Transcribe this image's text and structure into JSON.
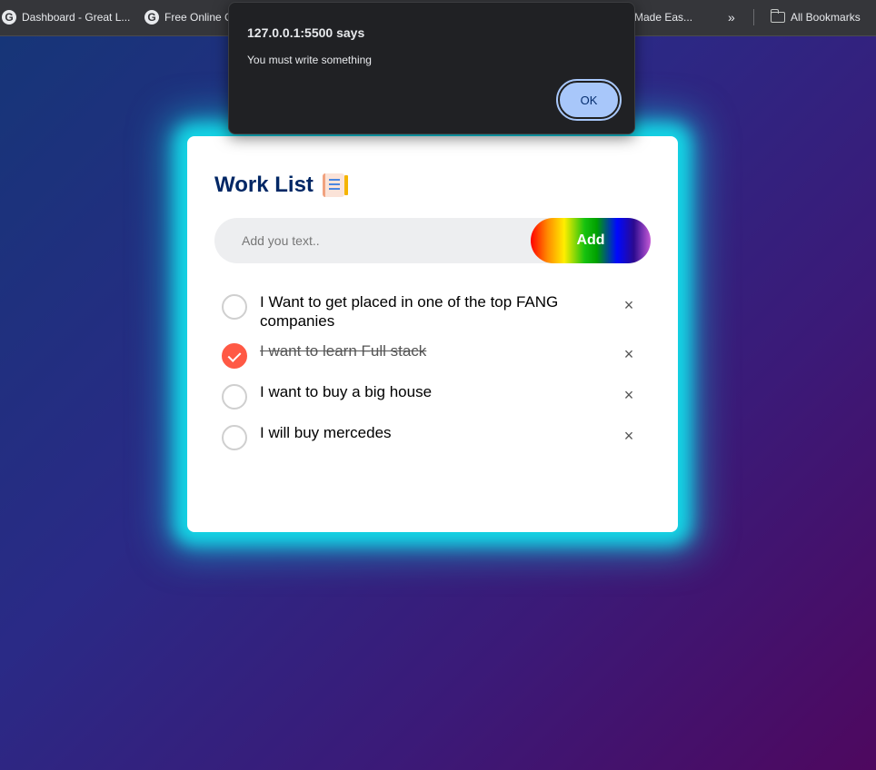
{
  "bookmarks": {
    "items": [
      {
        "label": "Dashboard - Great L..."
      },
      {
        "label": "Free Online C"
      },
      {
        "label": "Made Eas..."
      }
    ],
    "more": "»",
    "all_bookmarks": "All Bookmarks",
    "favicon_letter": "G"
  },
  "app": {
    "title": "Work List",
    "input": {
      "placeholder": "Add you text..",
      "value": ""
    },
    "add_label": "Add",
    "tasks": [
      {
        "text": "I Want to get placed in one of the top FANG companies",
        "done": false
      },
      {
        "text": "I want to learn Full stack",
        "done": true
      },
      {
        "text": "I want to buy a big house",
        "done": false
      },
      {
        "text": "I will buy mercedes",
        "done": false
      }
    ],
    "remove_symbol": "×"
  },
  "alert": {
    "title": "127.0.0.1:5500 says",
    "message": "You must write something",
    "ok_label": "OK"
  },
  "colors": {
    "accent_check": "#ff5945",
    "glow": "#14d6e6",
    "title_color": "#002765"
  }
}
